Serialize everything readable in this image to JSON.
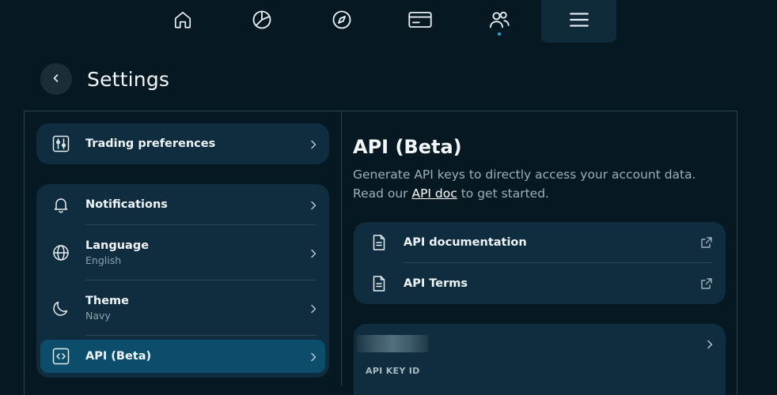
{
  "nav": {
    "items": [
      {
        "icon": "home-icon"
      },
      {
        "icon": "pie-chart-icon"
      },
      {
        "icon": "compass-icon"
      },
      {
        "icon": "credit-card-icon"
      },
      {
        "icon": "users-icon",
        "has_indicator": true
      },
      {
        "icon": "menu-icon",
        "active": true
      }
    ],
    "indicator_color": "#2aa7d9"
  },
  "header": {
    "back_icon": "chevron-left-icon",
    "title": "Settings"
  },
  "left_menu": {
    "trading": {
      "label": "Trading preferences",
      "icon": "sliders-icon"
    },
    "items": [
      {
        "label": "Notifications",
        "sub": "",
        "icon": "bell-icon"
      },
      {
        "label": "Language",
        "sub": "English",
        "icon": "globe-icon"
      },
      {
        "label": "Theme",
        "sub": "Navy",
        "icon": "moon-icon"
      },
      {
        "label": "API (Beta)",
        "sub": "",
        "icon": "code-icon",
        "selected": true
      }
    ]
  },
  "right": {
    "title": "API (Beta)",
    "desc_line1": "Generate API keys to directly access your account data.",
    "desc_prefix": "Read our ",
    "desc_link": "API doc",
    "desc_suffix": " to get started.",
    "links": [
      {
        "label": "API documentation",
        "icon": "document-icon"
      },
      {
        "label": "API Terms",
        "icon": "document-icon"
      }
    ],
    "key_card": {
      "label": "API KEY ID"
    }
  },
  "colors": {
    "background": "#061923",
    "card": "#0f2d3e",
    "selected": "#0b4d6a",
    "border": "#2b4250"
  }
}
